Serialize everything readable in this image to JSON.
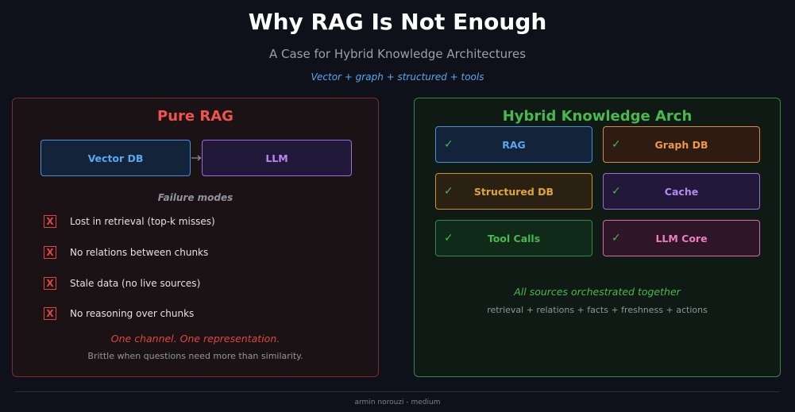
{
  "header": {
    "title": "Why RAG Is Not Enough",
    "subtitle": "A Case for Hybrid Knowledge Architectures",
    "tagline": "Vector + graph + structured + tools"
  },
  "left_panel": {
    "title": "Pure RAG",
    "flow": [
      "Vector DB",
      "LLM"
    ],
    "failure_title": "Failure modes",
    "failure_marker": "X",
    "failures": [
      "Lost in retrieval (top-k misses)",
      "No relations between chunks",
      "Stale data (no live sources)",
      "No reasoning over chunks"
    ],
    "note": "One channel. One representation.",
    "subnote": "Brittle when questions need more than similarity."
  },
  "right_panel": {
    "title": "Hybrid Knowledge Arch",
    "check": "✓",
    "components": [
      {
        "label": "RAG",
        "color": "#5aa7ee",
        "border": "#4b8fd9",
        "bg": "#12233a"
      },
      {
        "label": "Graph DB",
        "color": "#f0974a",
        "border": "#d9893f",
        "bg": "#2e1c12"
      },
      {
        "label": "Structured DB",
        "color": "#e0a53a",
        "border": "#c9942f",
        "bg": "#2a2112"
      },
      {
        "label": "Cache",
        "color": "#b58af0",
        "border": "#9a6ed8",
        "bg": "#22183a"
      },
      {
        "label": "Tool Calls",
        "color": "#49b84f",
        "border": "#2f8a45",
        "bg": "#0f2a18"
      },
      {
        "label": "LLM Core",
        "color": "#f07cc0",
        "border": "#d76aab",
        "bg": "#2e1528"
      }
    ],
    "note": "All sources orchestrated together",
    "subnote": "retrieval + relations + facts + freshness + actions"
  },
  "footer": "armin norouzi  -  medium"
}
